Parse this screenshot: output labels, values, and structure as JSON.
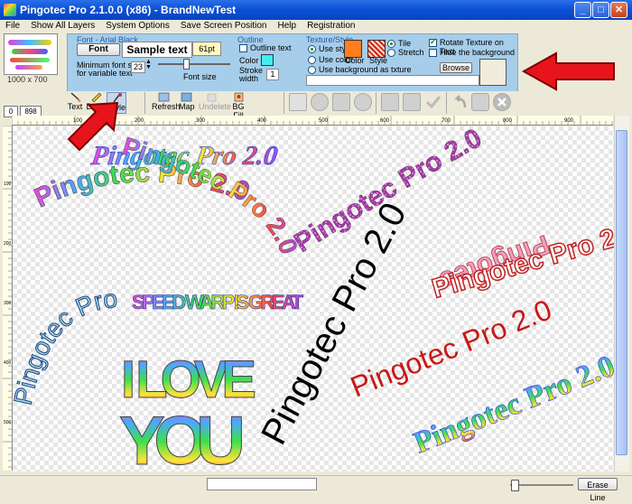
{
  "window": {
    "title": "Pingotec Pro 2.1.0.0 (x86) - BrandNewTest",
    "min": "_",
    "max": "□",
    "close": "✕"
  },
  "menu": [
    "File",
    "Show All Layers",
    "System Options",
    "Save Screen Position",
    "Help",
    "Registration"
  ],
  "thumbnail": {
    "size_label": "1000 x 700"
  },
  "font_group": {
    "title": "Font - Arial Black",
    "font_button": "Font",
    "sample_text": "Sample text",
    "size_badge": "61pt",
    "min_label_1": "Minimum font size",
    "min_label_2": "for variable text",
    "min_value": "23",
    "font_size_label": "Font size"
  },
  "outline_group": {
    "title": "Outline",
    "outline_text": "Outline text",
    "color_label": "Color",
    "stroke_label": "Stroke",
    "width_label": "width",
    "stroke_value": "1",
    "swatch_color": "#3ff0f0"
  },
  "texture_group": {
    "title": "Texture/Style",
    "use_style": "Use style",
    "use_color": "Use color",
    "use_background": "Use background as txture",
    "color_label": "Color",
    "style_label": "Style",
    "tile": "Tile",
    "stretch": "Stretch",
    "rotate": "Rotate Texture on Text",
    "hide_bg": "Hide the background",
    "browse": "Browse",
    "color_swatch": "#ff7f1f"
  },
  "position": {
    "x": "0",
    "y": "898"
  },
  "tools": {
    "text": "Text",
    "draw": "Draw",
    "style": "Style",
    "refresh": "Refresh",
    "map": "Map",
    "undelete": "Undelete",
    "bgfill": "BG Fill"
  },
  "ruler_h": [
    "100",
    "200",
    "300",
    "400",
    "500",
    "600",
    "700",
    "800",
    "900"
  ],
  "ruler_v": [
    "100",
    "200",
    "300",
    "400",
    "500",
    "600"
  ],
  "canvas_texts": {
    "t1": "Pingotec Pro 2.0",
    "t2": "Pingotec Pro 2.0",
    "t3": "Pingotec Pro 2.0",
    "t4": "Pingotec",
    "t5": "Pingotec Pro 2.0",
    "t6": "SPEED WARP IS GREAT",
    "t7": "Pingotec Pro 2.0",
    "t8": "Pingotec Pro 2.0",
    "t9": "Pingotec Pro 2.0",
    "t10": "I LOVE",
    "t11": "YOU",
    "t12": "Pingotec Pro 2.0",
    "t13": "Pingotec Pro 2.0"
  },
  "status": {
    "erase_line": "Erase Line"
  }
}
